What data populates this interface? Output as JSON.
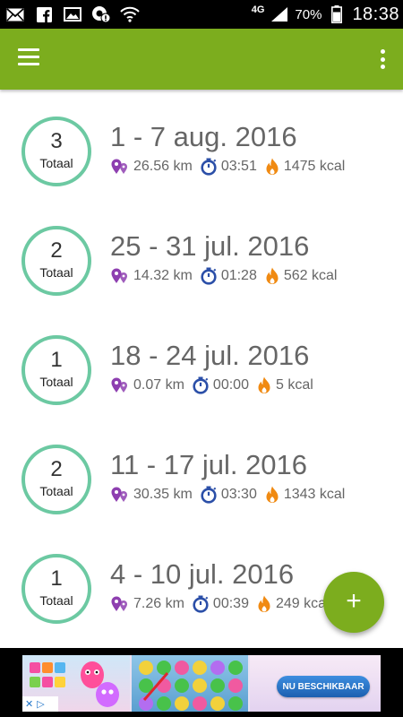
{
  "status_bar": {
    "network": "4G",
    "battery_percent": "70%",
    "time": "18:38",
    "left_icons": [
      "mail-icon",
      "facebook-icon",
      "image-icon",
      "notification-icon",
      "wifi-icon"
    ]
  },
  "app_bar": {
    "menu_icon": "menu-icon",
    "overflow_icon": "more-vertical-icon",
    "color": "#7cad1e"
  },
  "weeks": [
    {
      "count": "3",
      "count_label": "Totaal",
      "title": "1 - 7 aug. 2016",
      "distance": "26.56 km",
      "duration": "03:51",
      "calories": "1475 kcal"
    },
    {
      "count": "2",
      "count_label": "Totaal",
      "title": "25 - 31 jul. 2016",
      "distance": "14.32 km",
      "duration": "01:28",
      "calories": "562 kcal"
    },
    {
      "count": "1",
      "count_label": "Totaal",
      "title": "18 - 24 jul. 2016",
      "distance": "0.07 km",
      "duration": "00:00",
      "calories": "5 kcal"
    },
    {
      "count": "2",
      "count_label": "Totaal",
      "title": "11 - 17 jul. 2016",
      "distance": "30.35 km",
      "duration": "03:30",
      "calories": "1343 kcal"
    },
    {
      "count": "1",
      "count_label": "Totaal",
      "title": "4 - 10 jul. 2016",
      "distance": "7.26 km",
      "duration": "00:39",
      "calories": "249 kcal"
    }
  ],
  "fab": {
    "label": "+",
    "icon": "plus-icon"
  },
  "ad": {
    "cta": "NU BESCHIKBAAR"
  },
  "colors": {
    "accent": "#7cad1e",
    "circle": "#6cc9a2",
    "distance_icon": "#8e3fb0",
    "timer_icon": "#2b4fa8",
    "calories_icon": "#f08a12"
  }
}
